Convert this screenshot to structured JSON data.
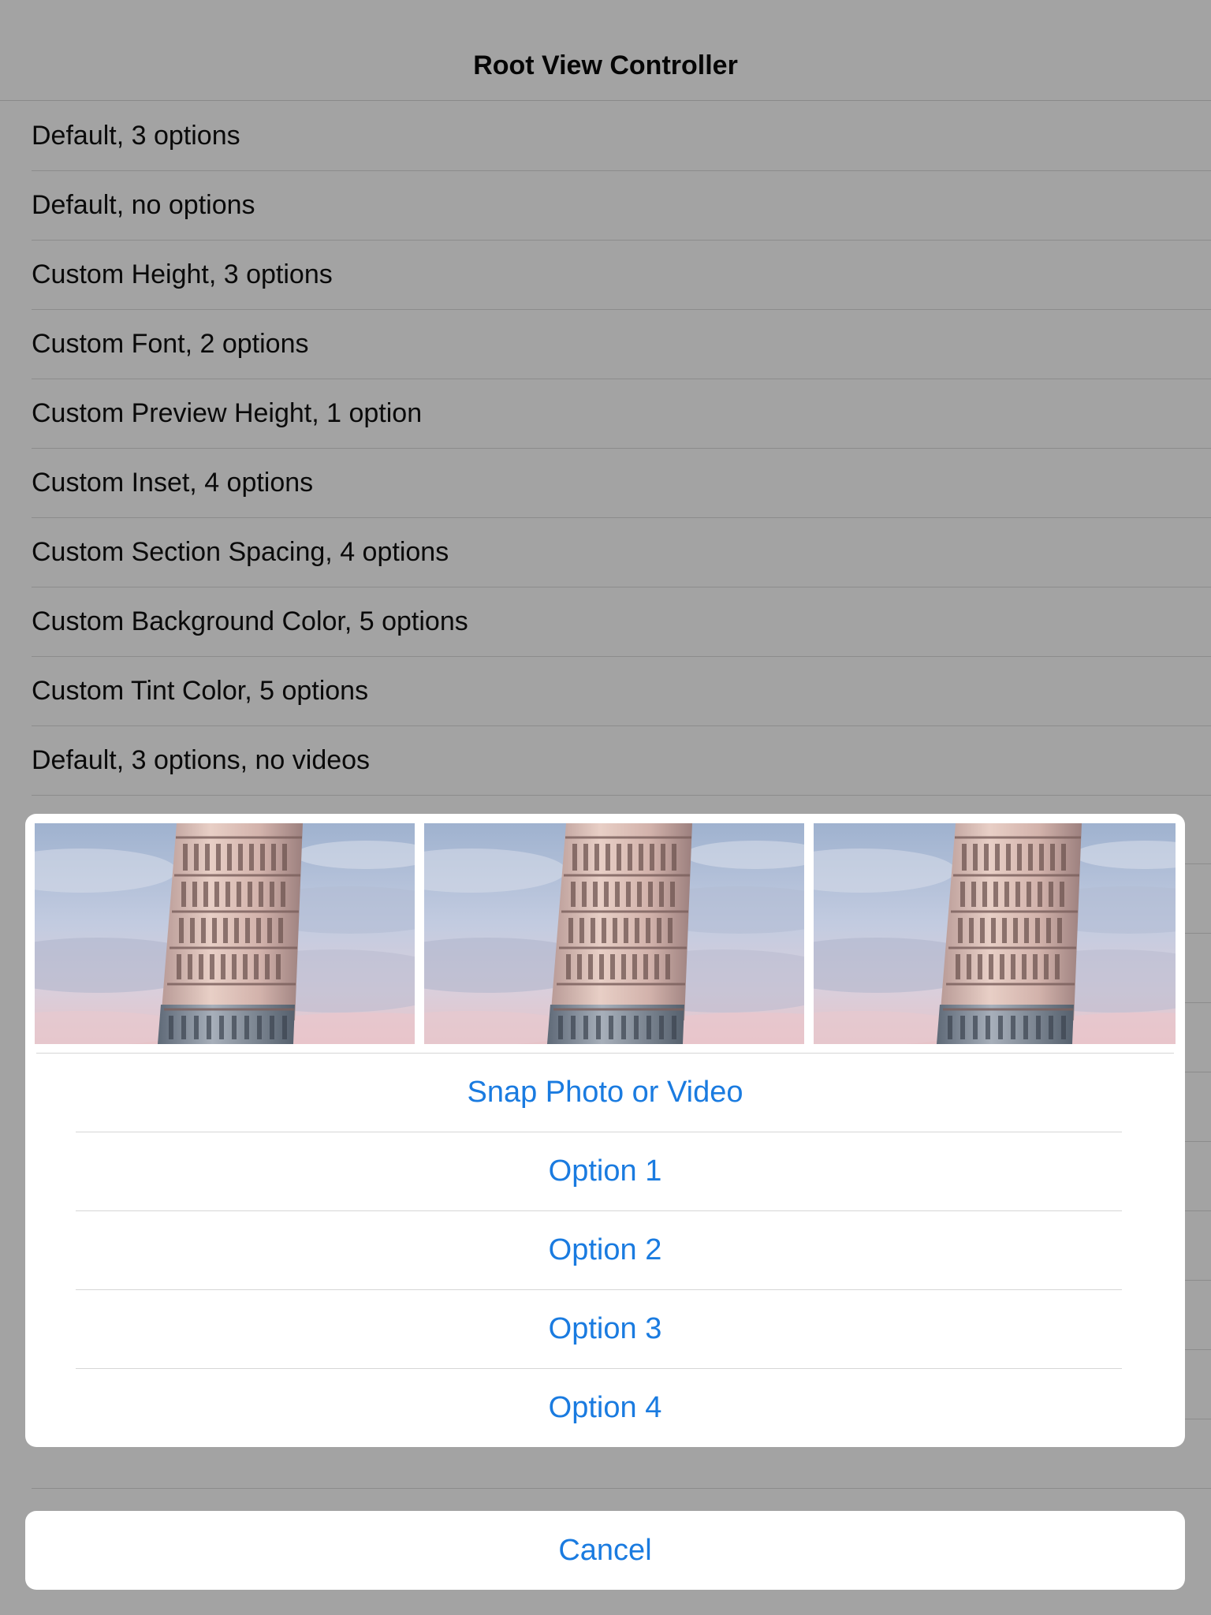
{
  "nav": {
    "title": "Root View Controller"
  },
  "rows": [
    "Default, 3 options",
    "Default, no options",
    "Custom Height, 3 options",
    "Custom Font, 2 options",
    "Custom Preview Height, 1 option",
    "Custom Inset, 4 options",
    "Custom Section Spacing, 4 options",
    "Custom Background Color, 5 options",
    "Custom Tint Color, 5 options",
    "Default, 3 options, no videos"
  ],
  "action_sheet": {
    "preview_images": [
      "leaning-tower-photo",
      "leaning-tower-photo",
      "leaning-tower-photo"
    ],
    "options": [
      "Snap Photo or Video",
      "Option 1",
      "Option 2",
      "Option 3",
      "Option 4"
    ],
    "cancel_label": "Cancel",
    "tint_color": "#1a7be0"
  }
}
